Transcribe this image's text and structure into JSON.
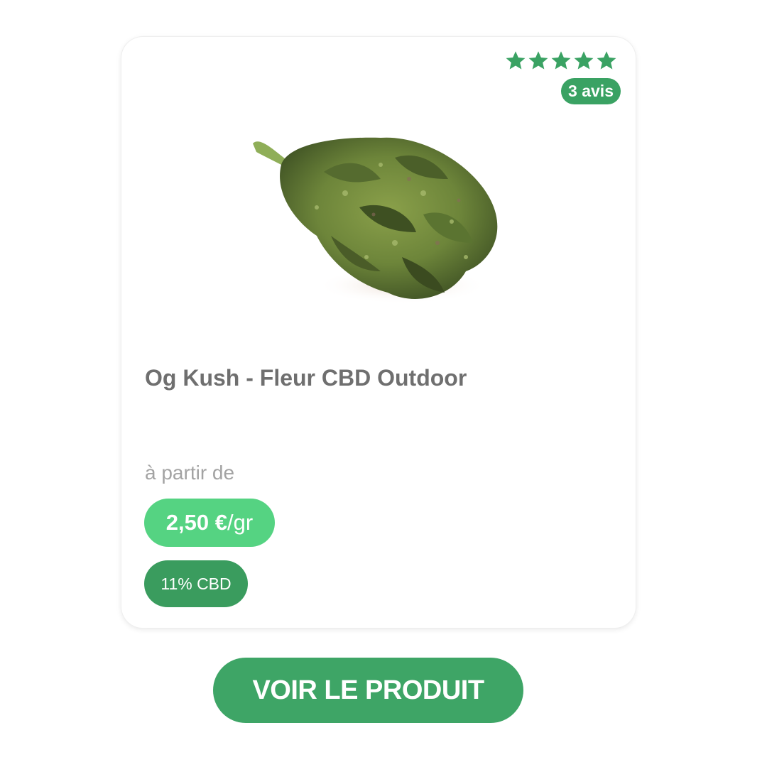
{
  "product": {
    "rating": {
      "stars": 5,
      "star_color": "#3aa263",
      "reviews_label": "3 avis"
    },
    "image_icon": "cbd-flower-bud-image",
    "title": "Og Kush - Fleur CBD Outdoor",
    "price": {
      "from_label": "à partir de",
      "amount": "2,50 €",
      "unit": "/gr",
      "pill_color": "#55d382"
    },
    "cbd_badge": {
      "label": "11% CBD",
      "color": "#3a9c5e"
    }
  },
  "cta": {
    "label": "VOIR LE PRODUIT",
    "color": "#3ea566"
  }
}
